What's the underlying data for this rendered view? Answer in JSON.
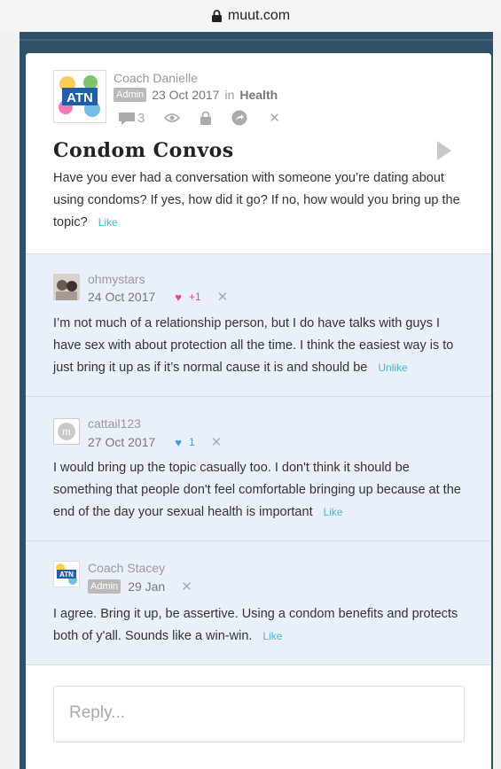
{
  "browser": {
    "url": "muut.com"
  },
  "post": {
    "author": "Coach Danielle",
    "badge": "Admin",
    "date": "23 Oct 2017",
    "in_label": "in",
    "category": "Health",
    "comment_count": "3",
    "title": "Condom Convos",
    "body": "Have you ever had a conversation with someone you’re dating about using condoms? If yes, how did it go? If no, how would you bring up the topic?",
    "like": "Like"
  },
  "replies": [
    {
      "author": "ohmystars",
      "date": "24 Oct 2017",
      "likes": "+1",
      "heart_color": "#e8449a",
      "text": "I’m not much of a relationship person, but I do have talks with guys I have sex with about protection all the time. I think the easiest way is to just bring it up as if it’s normal cause it is and should be",
      "action": "Unlike"
    },
    {
      "author": "cattail123",
      "date": "27 Oct 2017",
      "likes": "1",
      "heart_color": "#3aa2d6",
      "text": "I would bring up the topic casually too. I don't think it should be something that people don't feel comfortable bringing up because at the end of the day your sexual health is important",
      "action": "Like"
    },
    {
      "author": "Coach Stacey",
      "badge": "Admin",
      "date": "29 Jan",
      "text": "I agree. Bring it up, be assertive. Using a condom benefits and protects both of y'all. Sounds like a win-win.",
      "action": "Like"
    }
  ],
  "reply_input": {
    "placeholder": "Reply..."
  },
  "colors": {
    "frame": "#2e5168",
    "reply_bg": "#e9f0fa",
    "link": "#4ab3d6"
  }
}
